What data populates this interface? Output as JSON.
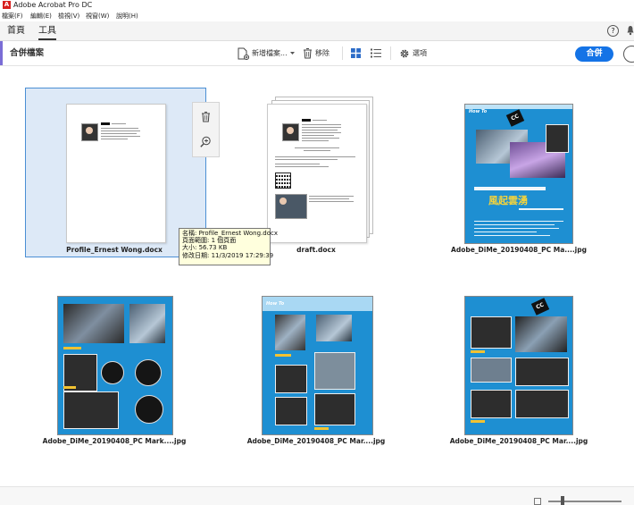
{
  "app": {
    "title": "Adobe Acrobat Pro DC",
    "logo_glyph": "A"
  },
  "menu": [
    "檔案(F)",
    "編輯(E)",
    "檢視(V)",
    "視窗(W)",
    "說明(H)"
  ],
  "tabs": [
    {
      "label": "首頁",
      "active": false
    },
    {
      "label": "工具",
      "active": true
    }
  ],
  "header_icons": {
    "help": "?"
  },
  "toolbar": {
    "title": "合併檔案",
    "add_files": "新增檔案...",
    "remove": "移除",
    "options": "選項",
    "combine": "合併"
  },
  "files": [
    {
      "name": "Profile_Ernest Wong.docx",
      "selected": true
    },
    {
      "name": "draft.docx",
      "selected": false
    },
    {
      "name": "Adobe_DiMe_20190408_PC Ma....jpg",
      "selected": false
    },
    {
      "name": "Adobe_DiMe_20190408_PC Mark....jpg",
      "selected": false
    },
    {
      "name": "Adobe_DiMe_20190408_PC Mar....jpg",
      "selected": false
    },
    {
      "name": "Adobe_DiMe_20190408_PC Mar....jpg",
      "selected": false
    }
  ],
  "thumb_text": {
    "how_to": "How To",
    "cc_badge": "CC",
    "cover_headline": "風起雲湧"
  },
  "tooltip": {
    "name": "名稱: Profile_Ernest Wong.docx",
    "pages": "頁面範圍: 1 個頁面",
    "size": "大小: 56.73 KB",
    "modified": "修改日期: 11/3/2019 17:29:39"
  },
  "colors": {
    "accent": "#1473e6",
    "selection": "#dde9f7",
    "tooltip_bg": "#ffffdd",
    "magazine_blue": "#1e8fd2",
    "logo_red": "#d8201e"
  }
}
